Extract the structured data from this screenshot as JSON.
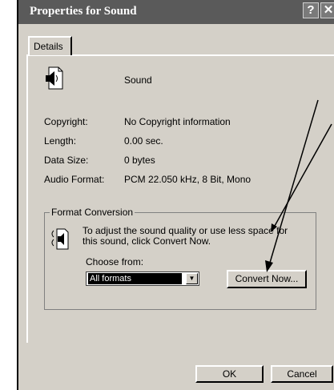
{
  "window": {
    "title": "Properties for Sound",
    "help_label": "?",
    "close_label": "✕"
  },
  "tabs": [
    {
      "label": "Details"
    }
  ],
  "details": {
    "name": "Sound",
    "rows": [
      {
        "label": "Copyright:",
        "value": "No Copyright information"
      },
      {
        "label": "Length:",
        "value": "0.00 sec."
      },
      {
        "label": "Data Size:",
        "value": "0 bytes"
      },
      {
        "label": "Audio Format:",
        "value": "PCM 22.050 kHz, 8 Bit, Mono"
      }
    ]
  },
  "format_conversion": {
    "title": "Format Conversion",
    "description": "To adjust the sound quality or use less space for this sound, click Convert Now.",
    "choose_label": "Choose from:",
    "selected_option": "All formats",
    "convert_button": "Convert Now..."
  },
  "buttons": {
    "ok": "OK",
    "cancel": "Cancel"
  },
  "icons": {
    "file": "sound-file-icon",
    "convert": "sound-convert-icon",
    "dropdown": "chevron-down-icon"
  },
  "colors": {
    "titlebar": "#5a5a5a",
    "dialog": "#d4d0c8",
    "selection": "#000000"
  }
}
